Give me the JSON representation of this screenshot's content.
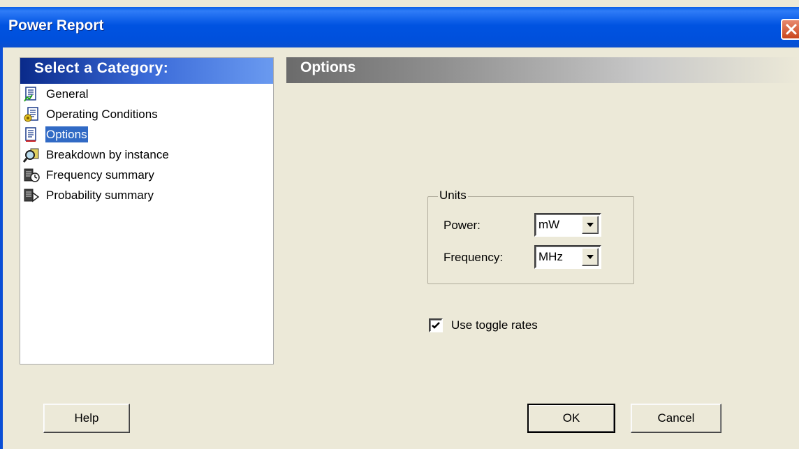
{
  "window": {
    "title": "Power Report"
  },
  "categories": {
    "header": "Select a Category:",
    "items": [
      {
        "label": "General",
        "icon": "report-icon",
        "selected": false
      },
      {
        "label": "Operating Conditions",
        "icon": "conditions-icon",
        "selected": false
      },
      {
        "label": "Options",
        "icon": "report-options-icon",
        "selected": true
      },
      {
        "label": "Breakdown by instance",
        "icon": "magnifier-icon",
        "selected": false
      },
      {
        "label": "Frequency summary",
        "icon": "frequency-icon",
        "selected": false
      },
      {
        "label": "Probability summary",
        "icon": "probability-icon",
        "selected": false
      }
    ]
  },
  "options": {
    "header": "Options",
    "units": {
      "legend": "Units",
      "power_label": "Power:",
      "power_value": "mW",
      "frequency_label": "Frequency:",
      "frequency_value": "MHz"
    },
    "toggle_rates": {
      "label": "Use toggle rates",
      "checked": true
    }
  },
  "buttons": {
    "help": "Help",
    "ok": "OK",
    "cancel": "Cancel"
  },
  "colors": {
    "titlebar": "#0053e1",
    "selection": "#316ac5",
    "dialog_bg": "#ece9d8"
  }
}
